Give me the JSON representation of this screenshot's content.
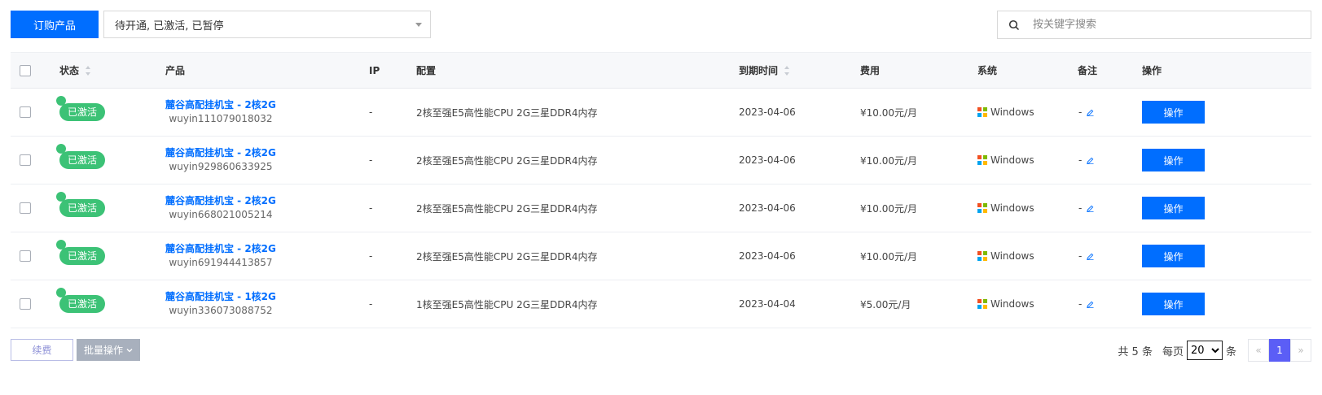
{
  "toolbar": {
    "buy_label": "订购产品",
    "status_filter_value": "待开通, 已激活, 已暂停",
    "search_placeholder": "按关键字搜索"
  },
  "table": {
    "headers": {
      "status": "状态",
      "product": "产品",
      "ip": "IP",
      "config": "配置",
      "expire": "到期时间",
      "fee": "费用",
      "system": "系统",
      "remark": "备注",
      "action": "操作"
    },
    "rows": [
      {
        "status": "已激活",
        "product": "麓谷高配挂机宝 - 2核2G",
        "id": "wuyin111079018032",
        "ip": "-",
        "config": "2核至强E5高性能CPU 2G三星DDR4内存",
        "expire": "2023-04-06",
        "fee": "¥10.00元/月",
        "system": "Windows",
        "remark": "-",
        "action": "操作"
      },
      {
        "status": "已激活",
        "product": "麓谷高配挂机宝 - 2核2G",
        "id": "wuyin929860633925",
        "ip": "-",
        "config": "2核至强E5高性能CPU 2G三星DDR4内存",
        "expire": "2023-04-06",
        "fee": "¥10.00元/月",
        "system": "Windows",
        "remark": "-",
        "action": "操作"
      },
      {
        "status": "已激活",
        "product": "麓谷高配挂机宝 - 2核2G",
        "id": "wuyin668021005214",
        "ip": "-",
        "config": "2核至强E5高性能CPU 2G三星DDR4内存",
        "expire": "2023-04-06",
        "fee": "¥10.00元/月",
        "system": "Windows",
        "remark": "-",
        "action": "操作"
      },
      {
        "status": "已激活",
        "product": "麓谷高配挂机宝 - 2核2G",
        "id": "wuyin691944413857",
        "ip": "-",
        "config": "2核至强E5高性能CPU 2G三星DDR4内存",
        "expire": "2023-04-06",
        "fee": "¥10.00元/月",
        "system": "Windows",
        "remark": "-",
        "action": "操作"
      },
      {
        "status": "已激活",
        "product": "麓谷高配挂机宝 - 1核2G",
        "id": "wuyin336073088752",
        "ip": "-",
        "config": "1核至强E5高性能CPU 2G三星DDR4内存",
        "expire": "2023-04-04",
        "fee": "¥5.00元/月",
        "system": "Windows",
        "remark": "-",
        "action": "操作"
      }
    ]
  },
  "footer": {
    "renew_label": "续费",
    "batch_label": "批量操作",
    "total_text": "共 5 条",
    "per_page_prefix": "每页",
    "per_page_value": "20",
    "per_page_suffix": "条",
    "prev_symbol": "«",
    "current_page": "1",
    "next_symbol": "»"
  },
  "colors": {
    "primary": "#006eff",
    "status_active": "#3cc276",
    "page_current": "#5b5ef6"
  },
  "icons": {
    "search": "search-icon",
    "windows": "windows-logo-icon",
    "edit": "pencil-icon",
    "dropdown": "chevron-down-icon"
  }
}
